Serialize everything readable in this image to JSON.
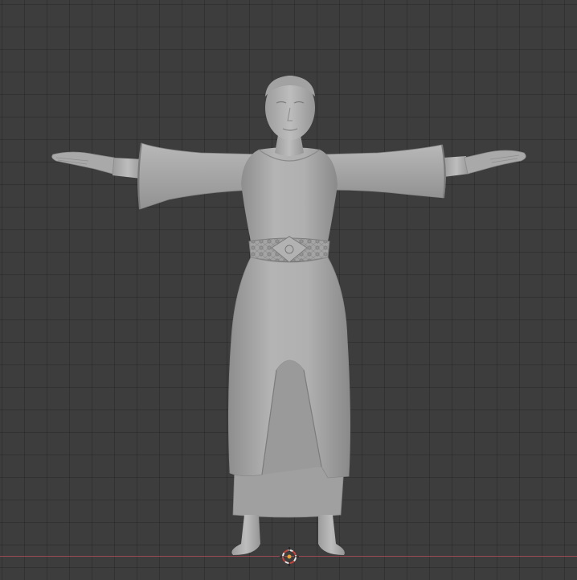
{
  "viewport": {
    "background_color": "#3d3d3d",
    "grid_color": "#2f2f2f",
    "x_axis_color": "#9a4a52"
  },
  "scene": {
    "object": "character-in-robe",
    "shading": "solid",
    "object_color": "#a8a8a8"
  },
  "cursor": {
    "icon": "3d-cursor-icon",
    "ring_color_primary": "#e8e8e8",
    "ring_color_secondary": "#c4443a",
    "center_color": "#e8a23a"
  }
}
